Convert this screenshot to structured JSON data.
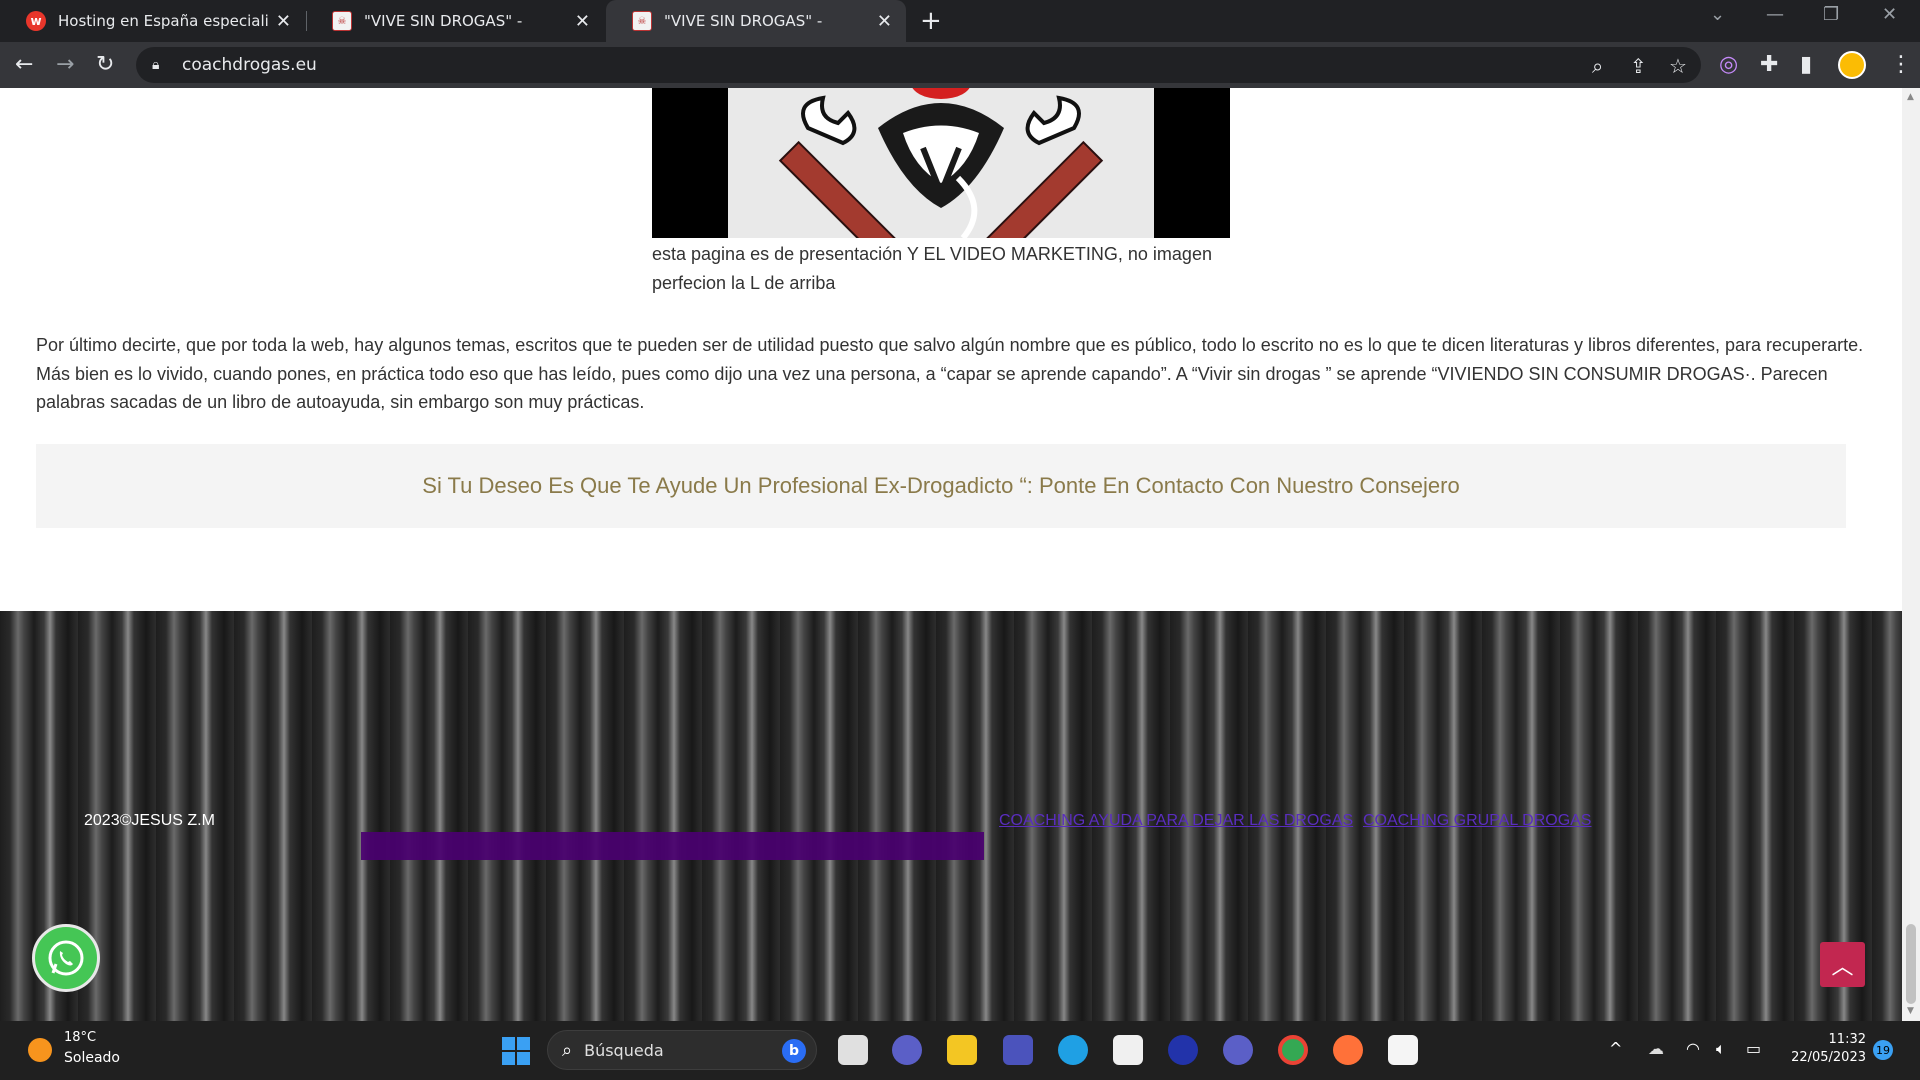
{
  "browser": {
    "tabs": [
      {
        "title": "Hosting en España especializado",
        "favicon": "w-logo-icon"
      },
      {
        "title": "\"VIVE SIN DROGAS\" -",
        "favicon": "site-favicon"
      },
      {
        "title": "\"VIVE SIN DROGAS\" -",
        "favicon": "site-favicon",
        "active": true
      }
    ],
    "url": "coachdrogas.eu",
    "accent": "#35363a"
  },
  "page": {
    "caption": "esta pagina es de presentación Y EL VIDEO MARKETING, no imagen perfecion la L de arriba",
    "paragraph": "Por último decirte, que por toda la web, hay algunos temas, escritos que te pueden ser de utilidad puesto que salvo algún nombre que es público, todo lo escrito no es lo que te dicen literaturas y libros diferentes, para recuperarte. Más bien es lo vivido, cuando pones, en práctica todo eso que has leído, pues como dijo una vez una persona, a “capar se aprende capando”. A “Vivir sin drogas ” se aprende “VIVIENDO SIN CONSUMIR DROGAS·. Parecen palabras sacadas de un libro de autoayuda, sin embargo son muy prácticas.",
    "cta": "Si Tu Deseo Es Que Te Ayude Un Profesional Ex-Drogadicto “: Ponte En Contacto Con Nuestro Consejero",
    "cta_color": "#8a7a4a"
  },
  "footer": {
    "copyright": "2023©JESUS Z.M",
    "links": [
      "COACHING AYUDA PARA DEJAR LAS DROGAS",
      "COACHING GRUPAL DROGAS"
    ],
    "to_top_color": "#c22750"
  },
  "taskbar": {
    "temperature": "18°C",
    "condition": "Soleado",
    "search_label": "Búsqueda",
    "time": "11:32",
    "date": "22/05/2023",
    "notifications": "19"
  }
}
